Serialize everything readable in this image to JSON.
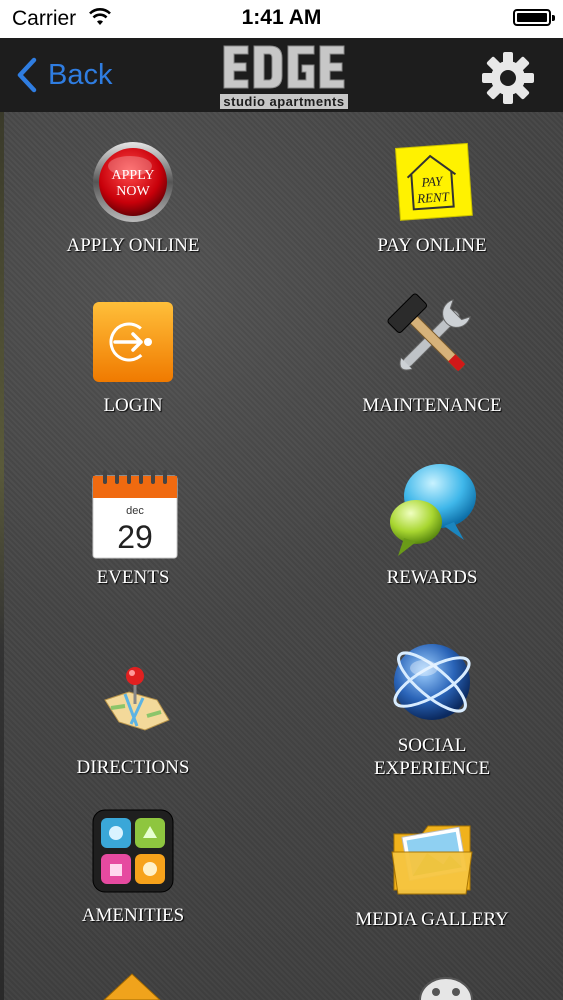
{
  "status_bar": {
    "carrier": "Carrier",
    "time": "1:41 AM"
  },
  "nav": {
    "back_label": "Back",
    "logo_tagline": "studio apartments",
    "accent_color": "#2f7de1"
  },
  "icons": {
    "apply_badge_line1": "APPLY",
    "apply_badge_line2": "NOW",
    "pay_note_line1": "PAY",
    "pay_note_line2": "RENT",
    "calendar_month": "dec",
    "calendar_day": "29"
  },
  "menu": [
    {
      "label": "APPLY ONLINE"
    },
    {
      "label": "PAY ONLINE"
    },
    {
      "label": "LOGIN"
    },
    {
      "label": "MAINTENANCE"
    },
    {
      "label": "EVENTS"
    },
    {
      "label": "REWARDS"
    },
    {
      "label": "DIRECTIONS"
    },
    {
      "label": "SOCIAL EXPERIENCE"
    },
    {
      "label": "AMENITIES"
    },
    {
      "label": "MEDIA GALLERY"
    }
  ]
}
